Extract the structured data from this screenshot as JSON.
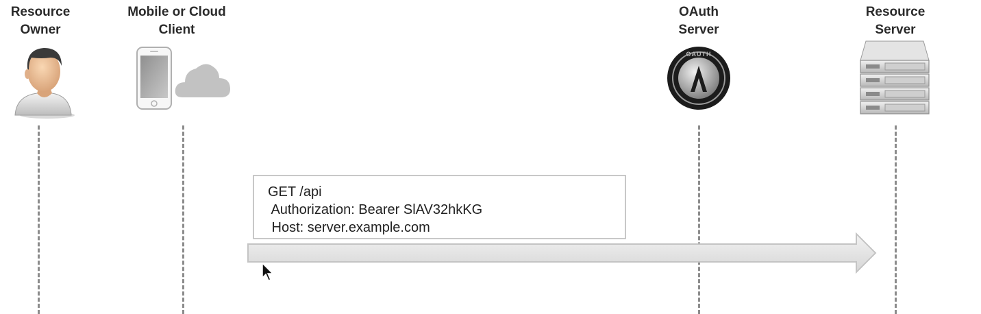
{
  "actors": [
    {
      "id": "resource-owner",
      "label": "Resource\nOwner",
      "icon": "person-icon"
    },
    {
      "id": "client",
      "label": "Mobile or Cloud\nClient",
      "icon": "phone-cloud-icon"
    },
    {
      "id": "oauth-server",
      "label": "OAuth\nServer",
      "icon": "oauth-logo-icon"
    },
    {
      "id": "resource-server",
      "label": "Resource\nServer",
      "icon": "server-rack-icon"
    }
  ],
  "message": {
    "line1": "GET /api",
    "line2": " Authorization: Bearer SlAV32hkKG",
    "line3": " Host: server.example.com",
    "direction": "client-to-resource-server"
  },
  "colors": {
    "lifeline": "#8c8c8c",
    "arrow_fill": "#e2e2e2",
    "arrow_stroke": "#c4c4c4",
    "box_border": "#c8c8c8"
  }
}
